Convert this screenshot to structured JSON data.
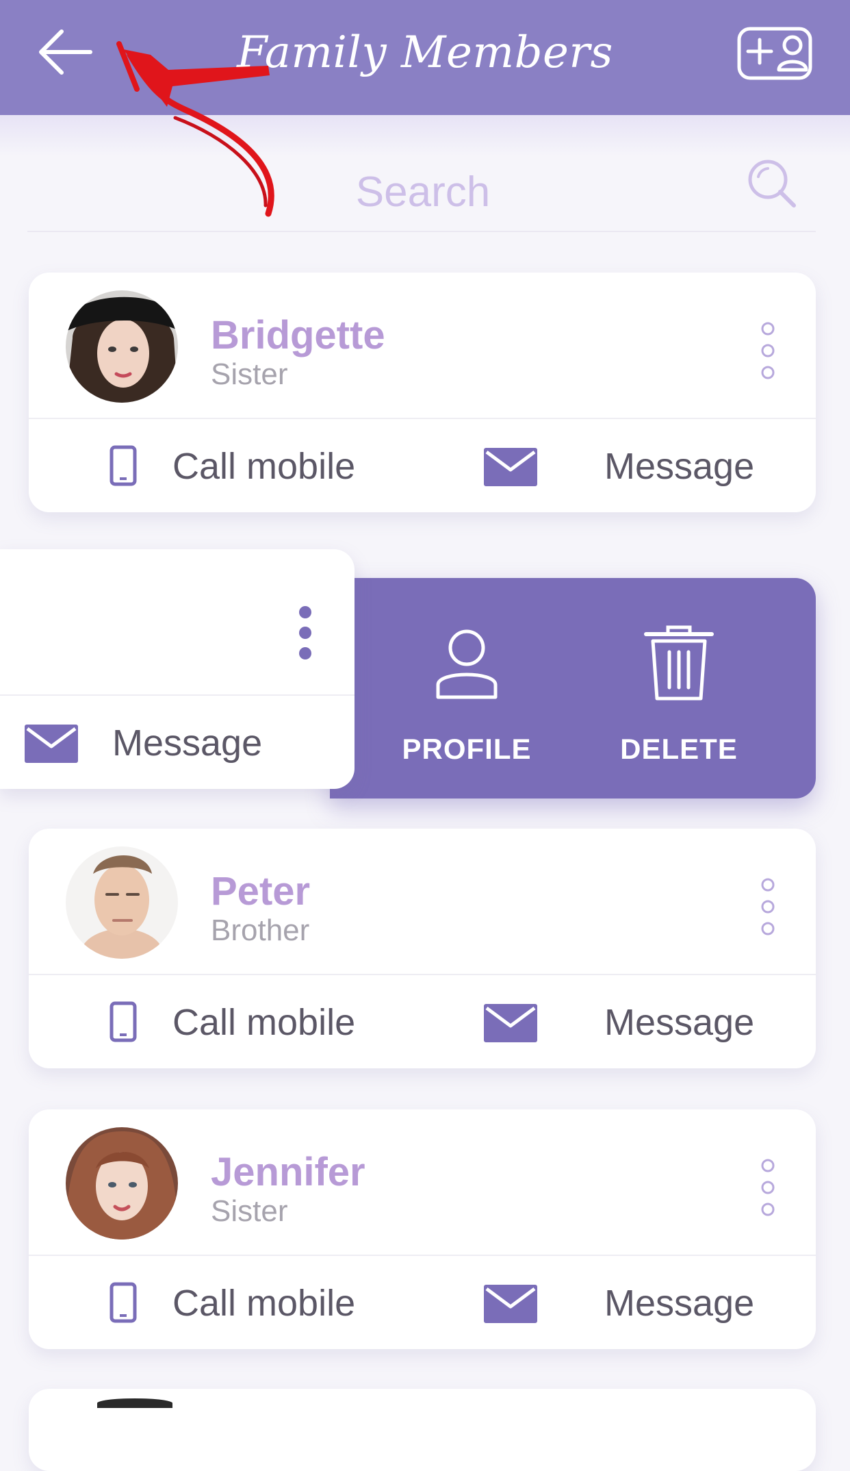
{
  "header": {
    "title": "Family Members",
    "back_icon": "arrow-left-icon",
    "add_icon": "add-user-icon"
  },
  "search": {
    "placeholder": "Search",
    "value": "",
    "icon": "search-icon"
  },
  "members": [
    {
      "name": "Bridgette",
      "relation": "Sister",
      "call_label": "Call mobile",
      "message_label": "Message"
    },
    {
      "name": "Peter",
      "relation": "Brother",
      "call_label": "Call mobile",
      "message_label": "Message"
    },
    {
      "name": "Jennifer",
      "relation": "Sister",
      "call_label": "Call mobile",
      "message_label": "Message"
    }
  ],
  "swiped_card": {
    "message_label": "Message",
    "actions": {
      "profile_label": "PROFILE",
      "delete_label": "DELETE"
    }
  },
  "colors": {
    "header": "#8a80c4",
    "accent": "#7a6db8",
    "name": "#b79ad6",
    "annotation_arrow": "#e0151b"
  }
}
